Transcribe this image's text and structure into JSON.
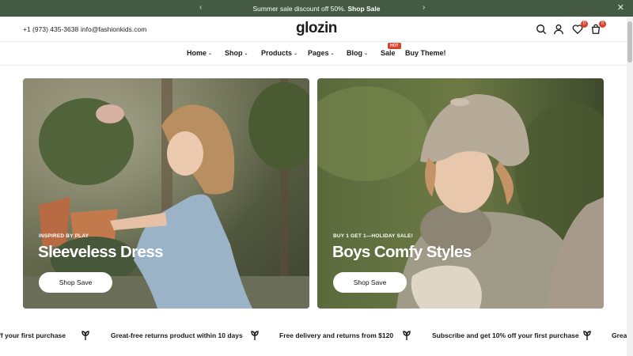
{
  "announcement": {
    "message": "Summer sale discount off 50%.",
    "link": "Shop Sale",
    "prev": "‹",
    "next": "›",
    "close": "✕"
  },
  "header": {
    "phone": "+1 (973) 435-3638",
    "email": "info@fashionkids.com",
    "logo": "glozin",
    "wishlist_count": "0",
    "cart_count": "0"
  },
  "nav": {
    "items": [
      "Home",
      "Shop",
      "Products",
      "Pages",
      "Blog",
      "Sale",
      "Buy Theme!"
    ],
    "hot_label": "HOT"
  },
  "banners": [
    {
      "eyebrow": "INSPIRED BY PLAY",
      "title": "Sleeveless Dress",
      "button": "Shop Save"
    },
    {
      "eyebrow": "BUY 1 GET 1—HOLIDAY SALE!",
      "title": "Boys Comfy Styles",
      "button": "Shop Save"
    }
  ],
  "marquee": [
    "ff your first purchase",
    "Great-free returns product within 10 days",
    "Free delivery and returns from $120",
    "Subscribe and get 10% off your first purchase",
    "Grea"
  ],
  "colors": {
    "announcement_bg": "#445a42",
    "badge": "#d9432c"
  }
}
